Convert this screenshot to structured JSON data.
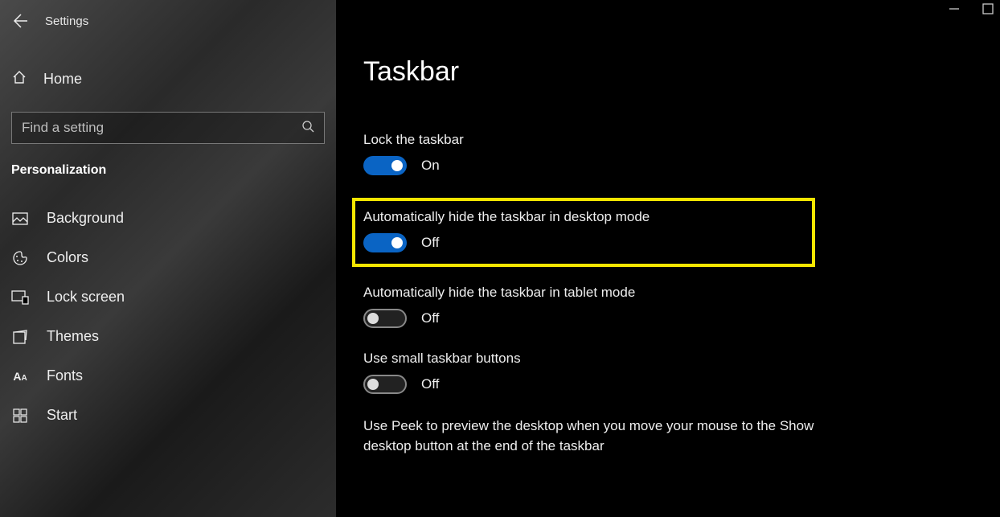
{
  "header": {
    "app_title": "Settings"
  },
  "sidebar": {
    "home_label": "Home",
    "search_placeholder": "Find a setting",
    "category": "Personalization",
    "items": [
      {
        "label": "Background"
      },
      {
        "label": "Colors"
      },
      {
        "label": "Lock screen"
      },
      {
        "label": "Themes"
      },
      {
        "label": "Fonts"
      },
      {
        "label": "Start"
      }
    ]
  },
  "main": {
    "title": "Taskbar",
    "settings": {
      "lock": {
        "label": "Lock the taskbar",
        "state": "On"
      },
      "autohide_desktop": {
        "label": "Automatically hide the taskbar in desktop mode",
        "state": "Off"
      },
      "autohide_tablet": {
        "label": "Automatically hide the taskbar in tablet mode",
        "state": "Off"
      },
      "small_buttons": {
        "label": "Use small taskbar buttons",
        "state": "Off"
      },
      "peek_desc": "Use Peek to preview the desktop when you move your mouse to the Show desktop button at the end of the taskbar"
    }
  }
}
